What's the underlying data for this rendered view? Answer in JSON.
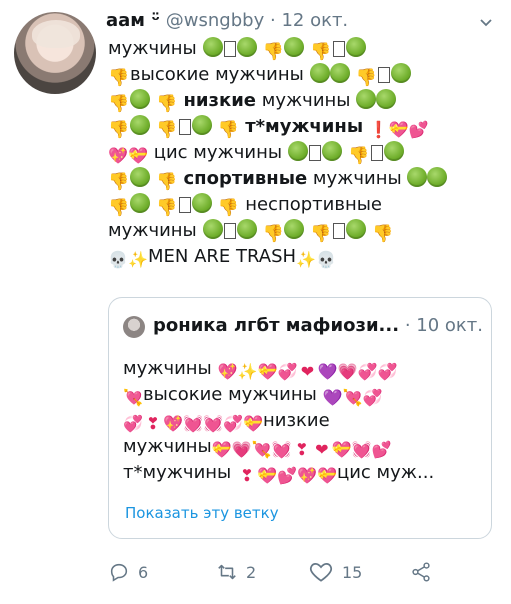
{
  "tweet": {
    "author_name": "аам ᵕ̈",
    "handle": "@wsngbby",
    "date_sep": "·",
    "date": "12 окт.",
    "lines": [
      {
        "t1": "мужчины"
      },
      {
        "t1": "высокие мужчины"
      },
      {
        "t1": "низкие",
        "t2": " мужчины"
      },
      {
        "t1": "т*мужчины"
      },
      {
        "t1": " цис мужчины"
      },
      {
        "t1": "спортивные",
        "t2": " мужчины"
      },
      {
        "t1": " неспортивные"
      },
      {
        "t1": "мужчины"
      },
      {
        "t1": "MEN ARE TRASH"
      }
    ]
  },
  "quote": {
    "author_name": "роника лгбт мафиози...",
    "date_sep": "·",
    "date": "10 окт.",
    "lines": [
      {
        "t1": "мужчины"
      },
      {
        "t1": "высокие мужчины"
      },
      {
        "t1": "низкие"
      },
      {
        "t1": "мужчины"
      },
      {
        "t1": "т*мужчины",
        "t2": "цис муж..."
      }
    ],
    "show_thread": "Показать эту ветку"
  },
  "actions": {
    "reply_count": "6",
    "retweet_count": "2",
    "like_count": "15"
  },
  "icons": {
    "sick": "nauseated-face-icon",
    "thumb": "thumbs-down-icon",
    "box": "missing-glyph-box",
    "heart": "heart-icon",
    "skull": "skull-icon",
    "sparkles": "sparkles-icon"
  },
  "colors": {
    "link": "#1b95e0",
    "muted": "#657786",
    "border": "#ccd6dd"
  }
}
